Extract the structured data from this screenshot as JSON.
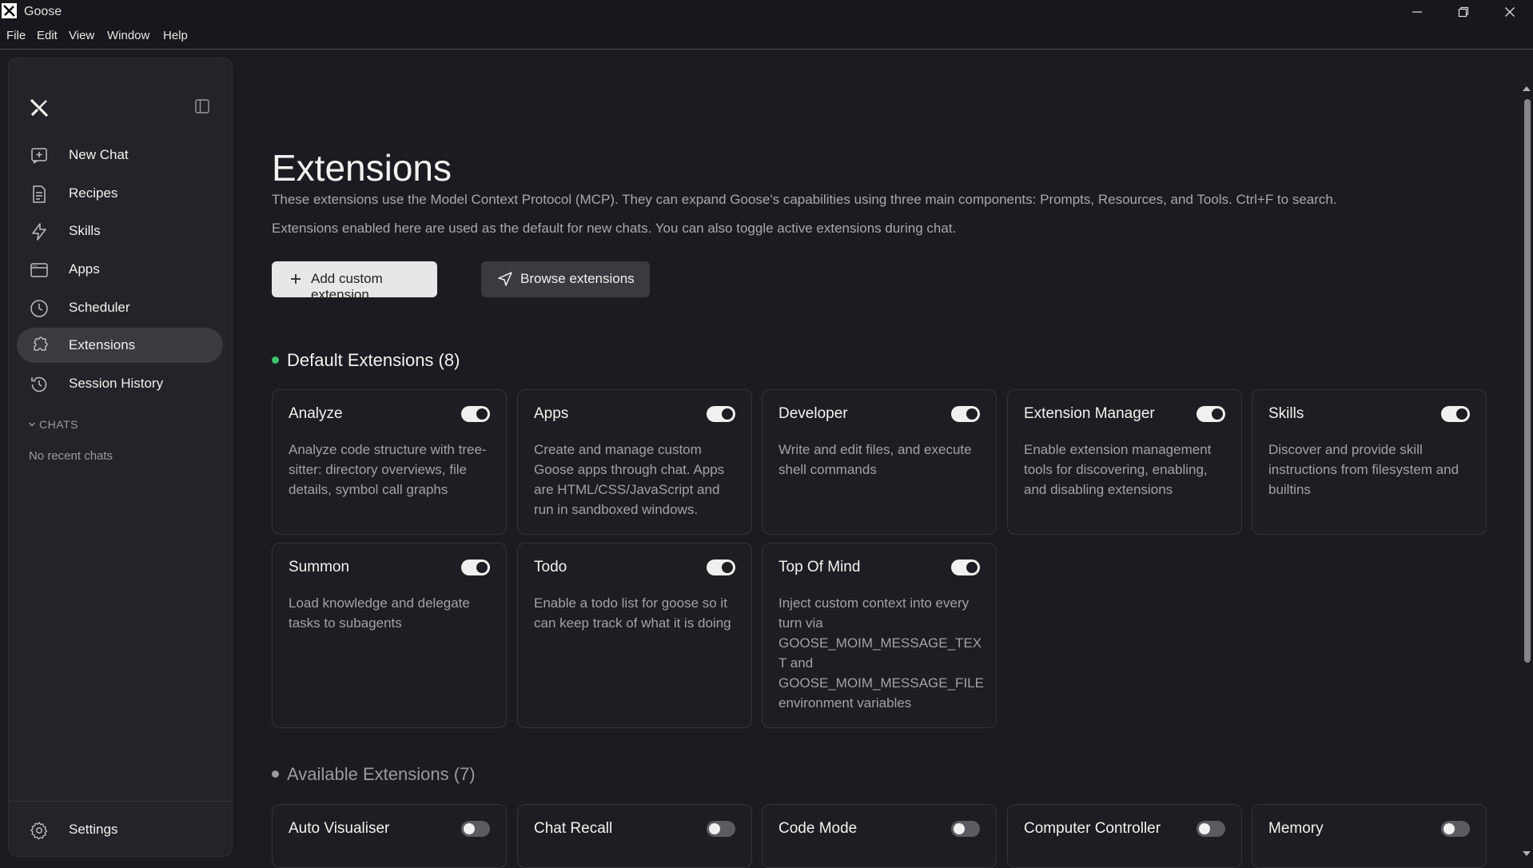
{
  "window": {
    "title": "Goose",
    "minimize": "—",
    "maximize": "❐",
    "close": "✕"
  },
  "menu": [
    "File",
    "Edit",
    "View",
    "Window",
    "Help"
  ],
  "sidebar": {
    "items": [
      {
        "label": "New Chat",
        "icon": "new-chat-icon"
      },
      {
        "label": "Recipes",
        "icon": "recipes-icon"
      },
      {
        "label": "Skills",
        "icon": "lightning-icon"
      },
      {
        "label": "Apps",
        "icon": "apps-icon"
      },
      {
        "label": "Scheduler",
        "icon": "clock-icon"
      },
      {
        "label": "Extensions",
        "icon": "puzzle-icon",
        "active": true
      },
      {
        "label": "Session History",
        "icon": "history-icon"
      }
    ],
    "chats_heading": "CHATS",
    "no_chats": "No recent chats",
    "settings": "Settings"
  },
  "main": {
    "title": "Extensions",
    "desc1": "These extensions use the Model Context Protocol (MCP). They can expand Goose's capabilities using three main components: Prompts, Resources, and Tools. Ctrl+F to search.",
    "desc2": "Extensions enabled here are used as the default for new chats. You can also toggle active extensions during chat.",
    "add_button": "Add custom extension",
    "browse_button": "Browse extensions",
    "default_heading": "Default Extensions (8)",
    "available_heading": "Available Extensions (7)",
    "default_extensions": [
      {
        "name": "Analyze",
        "desc": "Analyze code structure with tree-sitter: directory overviews, file details, symbol call graphs",
        "enabled": true
      },
      {
        "name": "Apps",
        "desc": "Create and manage custom Goose apps through chat. Apps are HTML/CSS/JavaScript and run in sandboxed windows.",
        "enabled": true
      },
      {
        "name": "Developer",
        "desc": "Write and edit files, and execute shell commands",
        "enabled": true
      },
      {
        "name": "Extension Manager",
        "desc": "Enable extension management tools for discovering, enabling, and disabling extensions",
        "enabled": true
      },
      {
        "name": "Skills",
        "desc": "Discover and provide skill instructions from filesystem and builtins",
        "enabled": true
      },
      {
        "name": "Summon",
        "desc": "Load knowledge and delegate tasks to subagents",
        "enabled": true
      },
      {
        "name": "Todo",
        "desc": "Enable a todo list for goose so it can keep track of what it is doing",
        "enabled": true
      },
      {
        "name": "Top Of Mind",
        "desc": "Inject custom context into every turn via GOOSE_MOIM_MESSAGE_TEXT and GOOSE_MOIM_MESSAGE_FILE environment variables",
        "enabled": true
      }
    ],
    "available_extensions": [
      {
        "name": "Auto Visualiser",
        "enabled": false
      },
      {
        "name": "Chat Recall",
        "enabled": false
      },
      {
        "name": "Code Mode",
        "enabled": false
      },
      {
        "name": "Computer Controller",
        "enabled": false
      },
      {
        "name": "Memory",
        "enabled": false
      }
    ]
  },
  "colors": {
    "accent_green": "#3ec46d",
    "available_dot": "#9a9ba0"
  }
}
